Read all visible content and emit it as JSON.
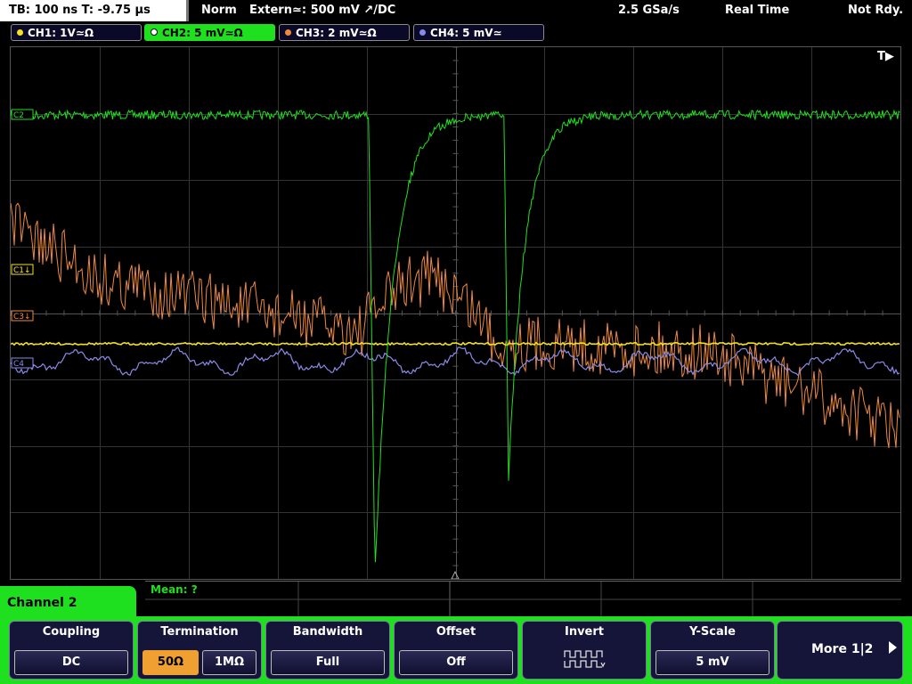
{
  "status": {
    "timebase": "TB: 100 ns   T: -9.75 µs",
    "mode": "Norm",
    "trigger": "Extern≃: 500 mV ↗/DC",
    "sample_rate": "2.5 GSa/s",
    "acq_mode": "Real Time",
    "ready": "Not Rdy."
  },
  "channels": [
    {
      "label": "CH1: 1V≃Ω",
      "color": "#f5e21a",
      "active": false
    },
    {
      "label": "CH2: 5 mV≃Ω",
      "color": "#1fe01f",
      "active": true
    },
    {
      "label": "CH3: 2 mV≃Ω",
      "color": "#f08a3a",
      "active": false
    },
    {
      "label": "CH4: 5 mV≃",
      "color": "#8a8ae8",
      "active": false
    }
  ],
  "screen": {
    "trigger_marker": "T▶",
    "markers": {
      "c1": "C1↓",
      "c2": "C2",
      "c3": "C3↓",
      "c4": "C4"
    }
  },
  "measure": {
    "mean_label": "Mean: ?"
  },
  "menu": {
    "channel_title": "Channel 2",
    "coupling": {
      "title": "Coupling",
      "value": "DC"
    },
    "termination": {
      "title": "Termination",
      "opt1": "50Ω",
      "opt2": "1MΩ"
    },
    "bandwidth": {
      "title": "Bandwidth",
      "value": "Full"
    },
    "offset": {
      "title": "Offset",
      "value": "Off"
    },
    "invert": {
      "title": "Invert"
    },
    "yscale": {
      "title": "Y-Scale",
      "value": "5 mV"
    },
    "more": {
      "label": "More 1|2"
    }
  },
  "icons": {
    "invert": "invert-waveform-icon",
    "more": "arrow-right-icon"
  }
}
